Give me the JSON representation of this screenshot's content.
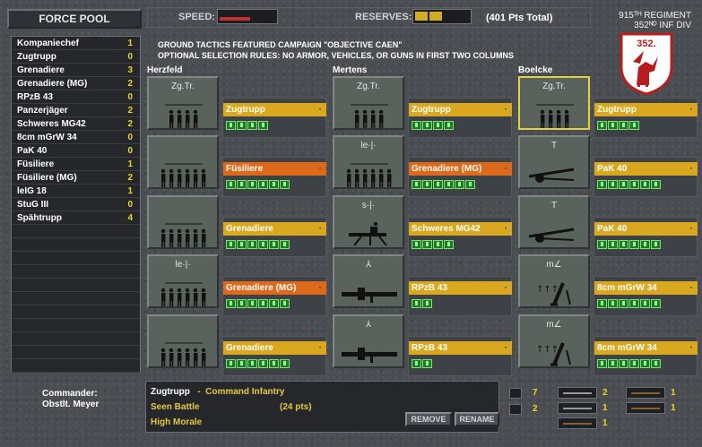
{
  "header": {
    "title": "FORCE POOL",
    "speed_label": "SPEED:",
    "reserves_label": "RESERVES:",
    "points_total": "(401 Pts Total)",
    "regiment_line1": "915ᵀᴴ REGIMENT",
    "regiment_line2": "352ᴺᴰ INF DIV",
    "emblem_text": "352.",
    "speed_level": 0.55,
    "reserves_level": 0.4
  },
  "campaign": {
    "line1": "GROUND TACTICS FEATURED CAMPAIGN \"OBJECTIVE CAEN\"",
    "line2": "OPTIONAL SELECTION RULES: NO ARMOR, VEHICLES, OR GUNS IN FIRST TWO COLUMNS"
  },
  "force_pool": [
    {
      "name": "Kompaniechef",
      "count": "1"
    },
    {
      "name": "Zugtrupp",
      "count": "0"
    },
    {
      "name": "Grenadiere",
      "count": "3"
    },
    {
      "name": "Grenadiere (MG)",
      "count": "2"
    },
    {
      "name": "RPzB 43",
      "count": "0"
    },
    {
      "name": "Panzerjäger",
      "count": "2"
    },
    {
      "name": "Schweres MG42",
      "count": "2"
    },
    {
      "name": "8cm mGrW 34",
      "count": "0"
    },
    {
      "name": "PaK 40",
      "count": "0"
    },
    {
      "name": "Füsiliere",
      "count": "1"
    },
    {
      "name": "Füsiliere (MG)",
      "count": "2"
    },
    {
      "name": "leIG 18",
      "count": "1"
    },
    {
      "name": "StuG III",
      "count": "0"
    },
    {
      "name": "Spähtrupp",
      "count": "4"
    }
  ],
  "columns": [
    {
      "name": "Herzfeld",
      "units": [
        {
          "tile_label": "Zg.Tr.",
          "icon": "infantry-squad-icon",
          "name": "Zugtrupp",
          "color": "gold",
          "men": 4
        },
        {
          "tile_label": "",
          "icon": "infantry-squad-icon",
          "name": "Füsiliere",
          "color": "orange",
          "men": 6
        },
        {
          "tile_label": "",
          "icon": "infantry-squad-icon",
          "name": "Grenadiere",
          "color": "gold",
          "men": 6
        },
        {
          "tile_label": "le·|·",
          "icon": "infantry-squad-icon",
          "name": "Grenadiere (MG)",
          "color": "orange",
          "men": 6
        },
        {
          "tile_label": "",
          "icon": "infantry-squad-icon",
          "name": "Grenadiere",
          "color": "gold",
          "men": 6
        }
      ]
    },
    {
      "name": "Mertens",
      "units": [
        {
          "tile_label": "Zg.Tr.",
          "icon": "infantry-squad-icon",
          "name": "Zugtrupp",
          "color": "gold",
          "men": 4
        },
        {
          "tile_label": "le·|·",
          "icon": "infantry-squad-icon",
          "name": "Grenadiere (MG)",
          "color": "orange",
          "men": 6
        },
        {
          "tile_label": "s·|·",
          "icon": "heavy-machine-gun-icon",
          "name": "Schweres MG42",
          "color": "gold",
          "men": 4
        },
        {
          "tile_label": "⅄",
          "icon": "bazooka-icon",
          "name": "RPzB 43",
          "color": "gold",
          "men": 2
        },
        {
          "tile_label": "⅄",
          "icon": "bazooka-icon",
          "name": "RPzB 43",
          "color": "gold",
          "men": 2
        }
      ]
    },
    {
      "name": "Boelcke",
      "units": [
        {
          "tile_label": "Zg.Tr.",
          "icon": "infantry-squad-icon",
          "name": "Zugtrupp",
          "color": "gold",
          "men": 4,
          "selected": true
        },
        {
          "tile_label": "T",
          "icon": "anti-tank-gun-icon",
          "name": "PaK 40",
          "color": "gold",
          "men": 6
        },
        {
          "tile_label": "T",
          "icon": "anti-tank-gun-icon",
          "name": "PaK 40",
          "color": "gold",
          "men": 6
        },
        {
          "tile_label": "m∠",
          "icon": "mortar-icon",
          "name": "8cm mGrW 34",
          "color": "gold",
          "men": 6
        },
        {
          "tile_label": "m∠",
          "icon": "mortar-icon",
          "name": "8cm mGrW 34",
          "color": "gold",
          "men": 6
        }
      ]
    }
  ],
  "commander": {
    "label": "Commander:",
    "name": "Obstlt. Meyer"
  },
  "selected_unit": {
    "name": "Zugtrupp",
    "type": "Command Infantry",
    "status1": "Seen Battle",
    "points": "(24 pts)",
    "status2": "High Morale"
  },
  "buttons": {
    "remove": "REMOVE",
    "rename": "RENAME"
  },
  "equipment": {
    "grenades": "7",
    "medkit": "2",
    "smg": "2",
    "rifle_a": "1",
    "rifle_b": "1",
    "lmg": "1",
    "rifle_c": "1"
  }
}
